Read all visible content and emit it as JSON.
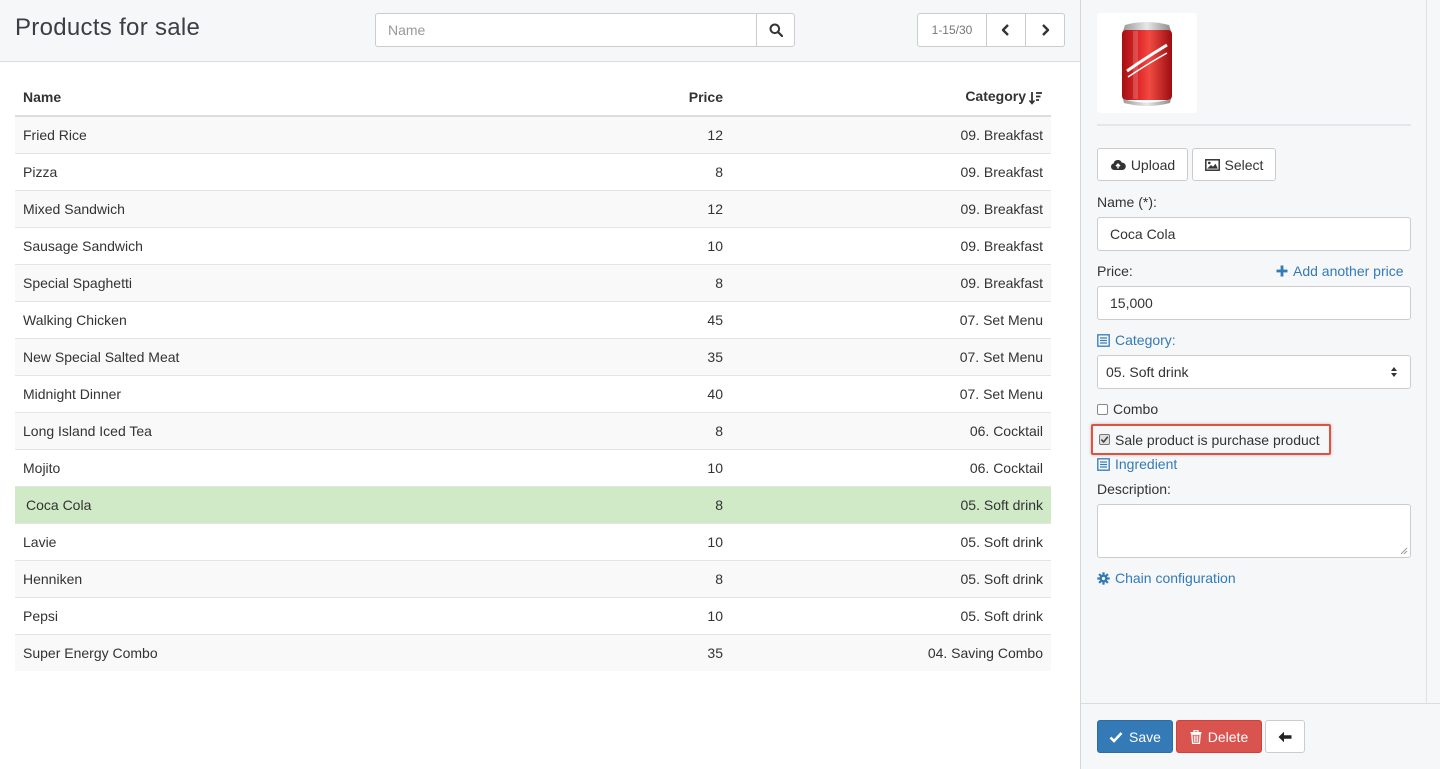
{
  "header": {
    "title": "Products for sale",
    "search_placeholder": "Name",
    "pager_info": "1-15/30"
  },
  "table": {
    "columns": {
      "name": "Name",
      "price": "Price",
      "category": "Category"
    },
    "rows": [
      {
        "name": "Fried Rice",
        "price": "12",
        "category": "09. Breakfast"
      },
      {
        "name": "Pizza",
        "price": "8",
        "category": "09. Breakfast"
      },
      {
        "name": "Mixed Sandwich",
        "price": "12",
        "category": "09. Breakfast"
      },
      {
        "name": "Sausage Sandwich",
        "price": "10",
        "category": "09. Breakfast"
      },
      {
        "name": "Special Spaghetti",
        "price": "8",
        "category": "09. Breakfast"
      },
      {
        "name": "Walking Chicken",
        "price": "45",
        "category": "07. Set Menu"
      },
      {
        "name": "New Special Salted Meat",
        "price": "35",
        "category": "07. Set Menu"
      },
      {
        "name": "Midnight Dinner",
        "price": "40",
        "category": "07. Set Menu"
      },
      {
        "name": "Long Island Iced Tea",
        "price": "8",
        "category": "06. Cocktail"
      },
      {
        "name": "Mojito",
        "price": "10",
        "category": "06. Cocktail"
      },
      {
        "name": "Coca Cola",
        "price": "8",
        "category": "05. Soft drink"
      },
      {
        "name": "Lavie",
        "price": "10",
        "category": "05. Soft drink"
      },
      {
        "name": "Henniken",
        "price": "8",
        "category": "05. Soft drink"
      },
      {
        "name": "Pepsi",
        "price": "10",
        "category": "05. Soft drink"
      },
      {
        "name": "Super Energy Combo",
        "price": "35",
        "category": "04. Saving Combo"
      }
    ]
  },
  "detail": {
    "upload_label": "Upload",
    "select_label": "Select",
    "name_label": "Name (*):",
    "name_value": "Coca Cola",
    "price_label": "Price:",
    "add_price_label": "Add another price",
    "price_value": "15,000",
    "category_label": "Category:",
    "category_value": "05. Soft drink",
    "combo_label": "Combo",
    "purchase_label": "Sale product is purchase product",
    "ingredient_label": "Ingredient",
    "description_label": "Description:",
    "chain_label": "Chain configuration",
    "save_label": "Save",
    "delete_label": "Delete"
  },
  "colors": {
    "selected_row": "#d0e9c6",
    "primary": "#337ab7",
    "danger": "#d9534f",
    "highlight_box": "#e0513f"
  },
  "icons": [
    "search-icon",
    "chevron-left-icon",
    "chevron-right-icon",
    "sort-icon",
    "cloud-upload-icon",
    "image-icon",
    "plus-icon",
    "list-icon",
    "gear-icon",
    "check-icon",
    "trash-icon",
    "arrow-left-icon"
  ]
}
